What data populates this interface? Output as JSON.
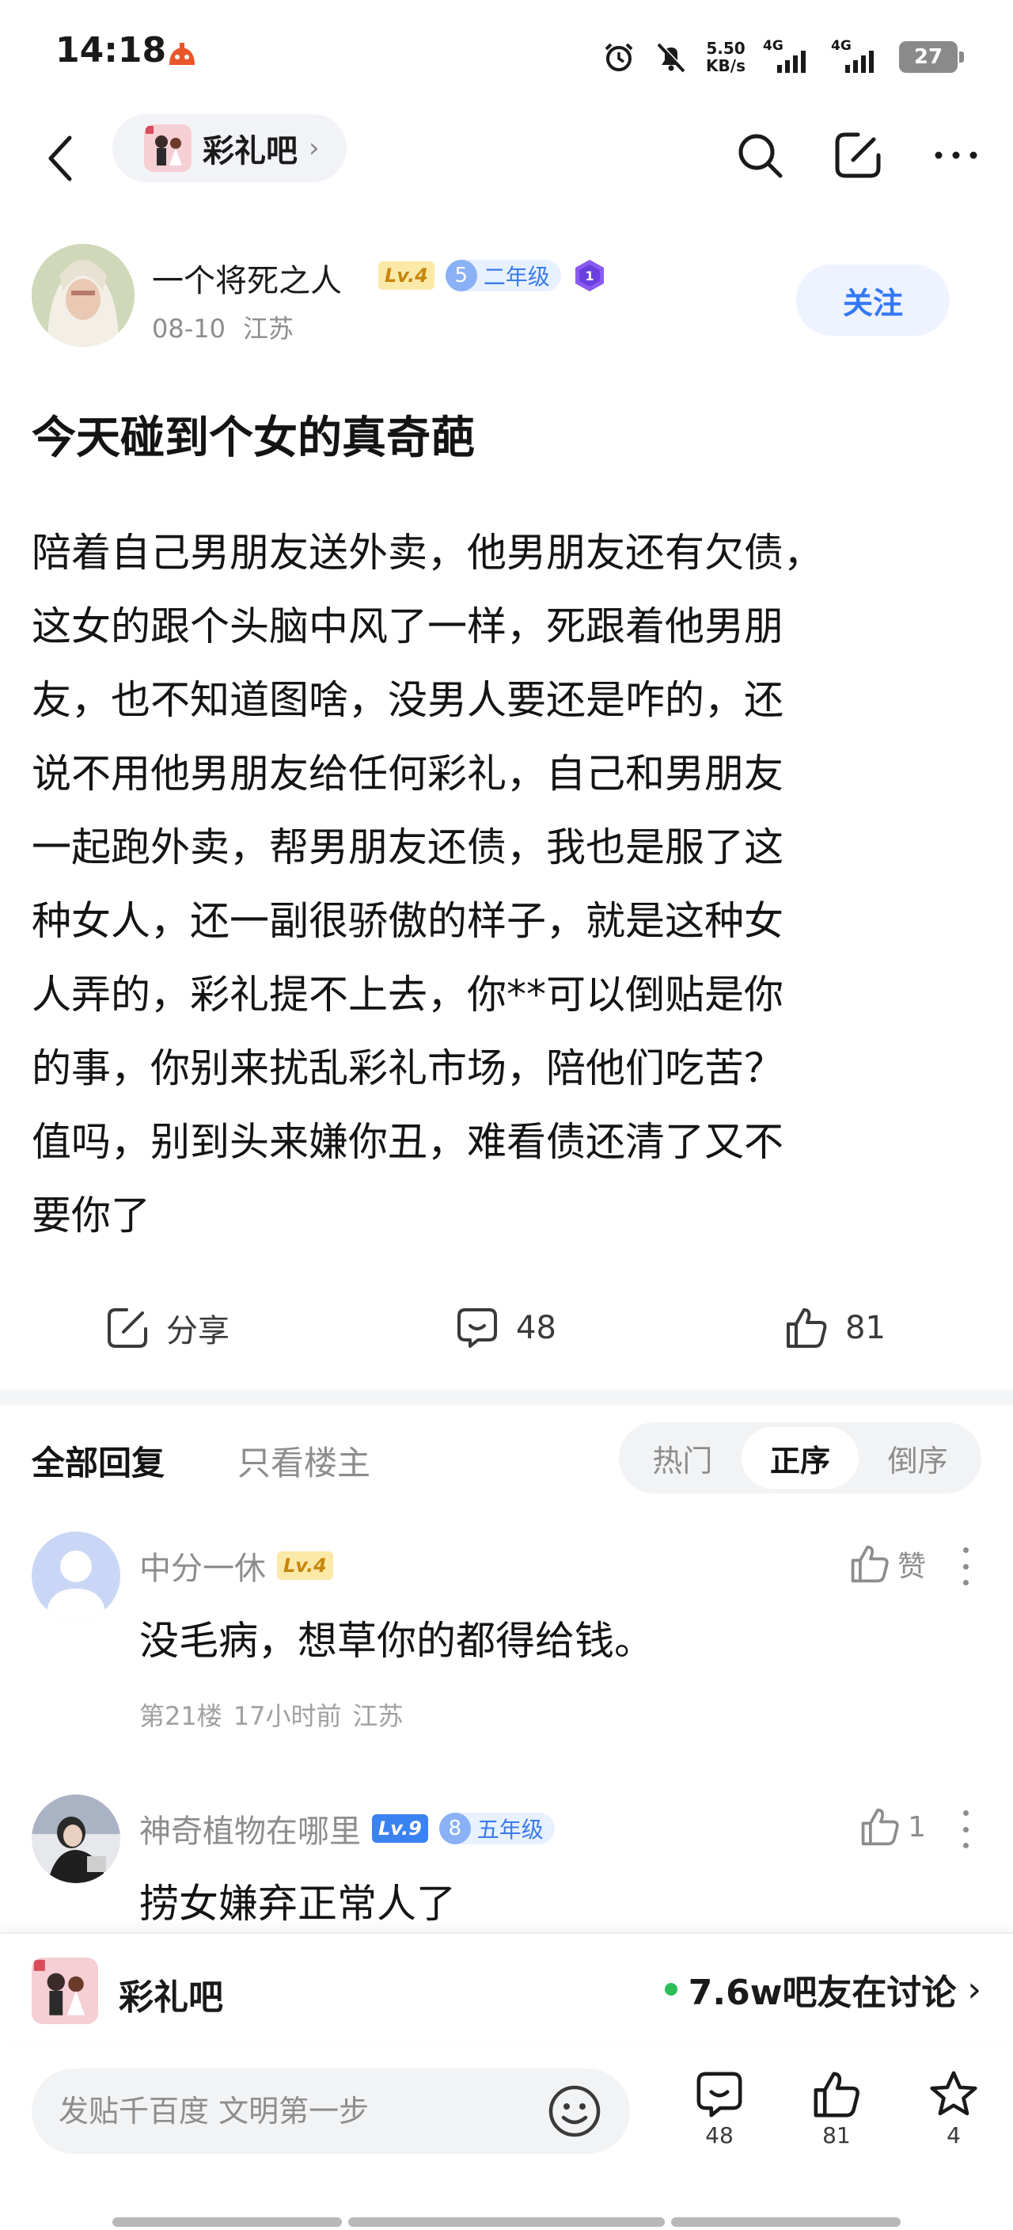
{
  "status_bar": {
    "time": "14:18",
    "net_speed_top": "5.50",
    "net_speed_bottom": "KB/s",
    "sim1": "4G",
    "sim2": "4G",
    "battery": "27",
    "icons": [
      "alarm-icon",
      "mute-icon",
      "signal-icon",
      "battery-icon"
    ]
  },
  "nav": {
    "forum_name": "彩礼吧",
    "icons": [
      "back-icon",
      "search-icon",
      "edit-icon",
      "more-icon"
    ]
  },
  "author": {
    "name": "一个将死之人",
    "level": "Lv.4",
    "grade_num": "5",
    "grade_label": "二年级",
    "medal_num": "1",
    "date": "08-10",
    "location": "江苏",
    "follow_label": "关注"
  },
  "post": {
    "title": "今天碰到个女的真奇葩",
    "body_lines": [
      "陪着自己男朋友送外卖，他男朋友还有欠债，",
      "这女的跟个头脑中风了一样，死跟着他男朋",
      "友，也不知道图啥，没男人要还是咋的，还",
      "说不用他男朋友给任何彩礼，自己和男朋友",
      "一起跑外卖，帮男朋友还债，我也是服了这",
      "种女人，还一副很骄傲的样子，就是这种女",
      "人弄的，彩礼提不上去，你**可以倒贴是你",
      "的事，你别来扰乱彩礼市场，陪他们吃苦？",
      "值吗，别到头来嫌你丑，难看债还清了又不",
      "要你了"
    ]
  },
  "actions": {
    "share_label": "分享",
    "comment_count": "48",
    "like_count": "81"
  },
  "reply_tabs": {
    "all": "全部回复",
    "host_only": "只看楼主",
    "sort": [
      "热门",
      "正序",
      "倒序"
    ],
    "active_sort": "正序"
  },
  "comments": [
    {
      "name": "中分一休",
      "level": "Lv.4",
      "like_label": "赞",
      "text": "没毛病，想草你的都得给钱。",
      "floor": "第21楼",
      "time": "17小时前",
      "location": "江苏"
    },
    {
      "name": "神奇植物在哪里",
      "level": "Lv.9",
      "grade_num": "8",
      "grade_label": "五年级",
      "like_count": "1",
      "text": "捞女嫌弃正常人了"
    }
  ],
  "forum_strip": {
    "name": "彩礼吧",
    "online_text": "7.6w吧友在讨论"
  },
  "bottom_bar": {
    "placeholder": "发贴千百度 文明第一步",
    "comment_count": "48",
    "like_count": "81",
    "fav_count": "4"
  },
  "colors": {
    "accent": "#3478f6",
    "level_yellow": "#fbe9a8",
    "level_blue": "#3a82f2",
    "online_green": "#2bbf5a"
  }
}
